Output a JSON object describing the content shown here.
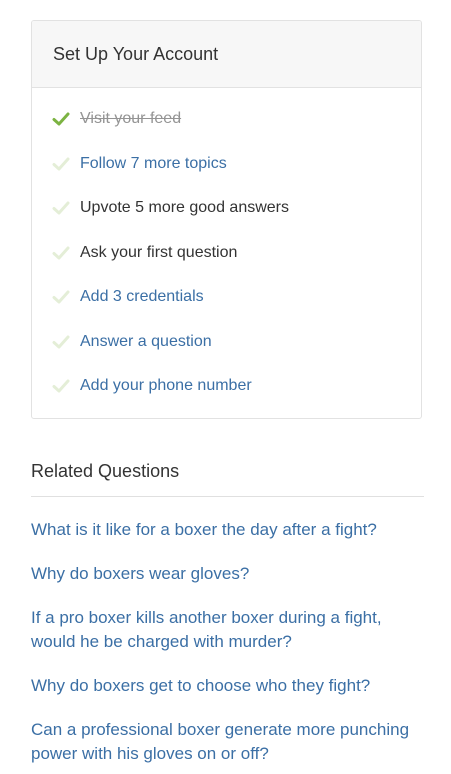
{
  "setup": {
    "title": "Set Up Your Account",
    "tasks": [
      {
        "label": "Visit your feed",
        "state": "done"
      },
      {
        "label": "Follow 7 more topics",
        "state": "link"
      },
      {
        "label": "Upvote 5 more good answers",
        "state": "plain"
      },
      {
        "label": "Ask your first question",
        "state": "plain"
      },
      {
        "label": "Add 3 credentials",
        "state": "link"
      },
      {
        "label": "Answer a question",
        "state": "link"
      },
      {
        "label": "Add your phone number",
        "state": "link"
      }
    ],
    "colors": {
      "check_done": "#7cb342",
      "check_pending": "#e4eed7"
    }
  },
  "related": {
    "title": "Related Questions",
    "questions": [
      "What is it like for a boxer the day after a fight?",
      "Why do boxers wear gloves?",
      "If a pro boxer kills another boxer during a fight, would he be charged with murder?",
      "Why do boxers get to choose who they fight?",
      "Can a professional boxer generate more punching power with his gloves on or off?"
    ]
  }
}
